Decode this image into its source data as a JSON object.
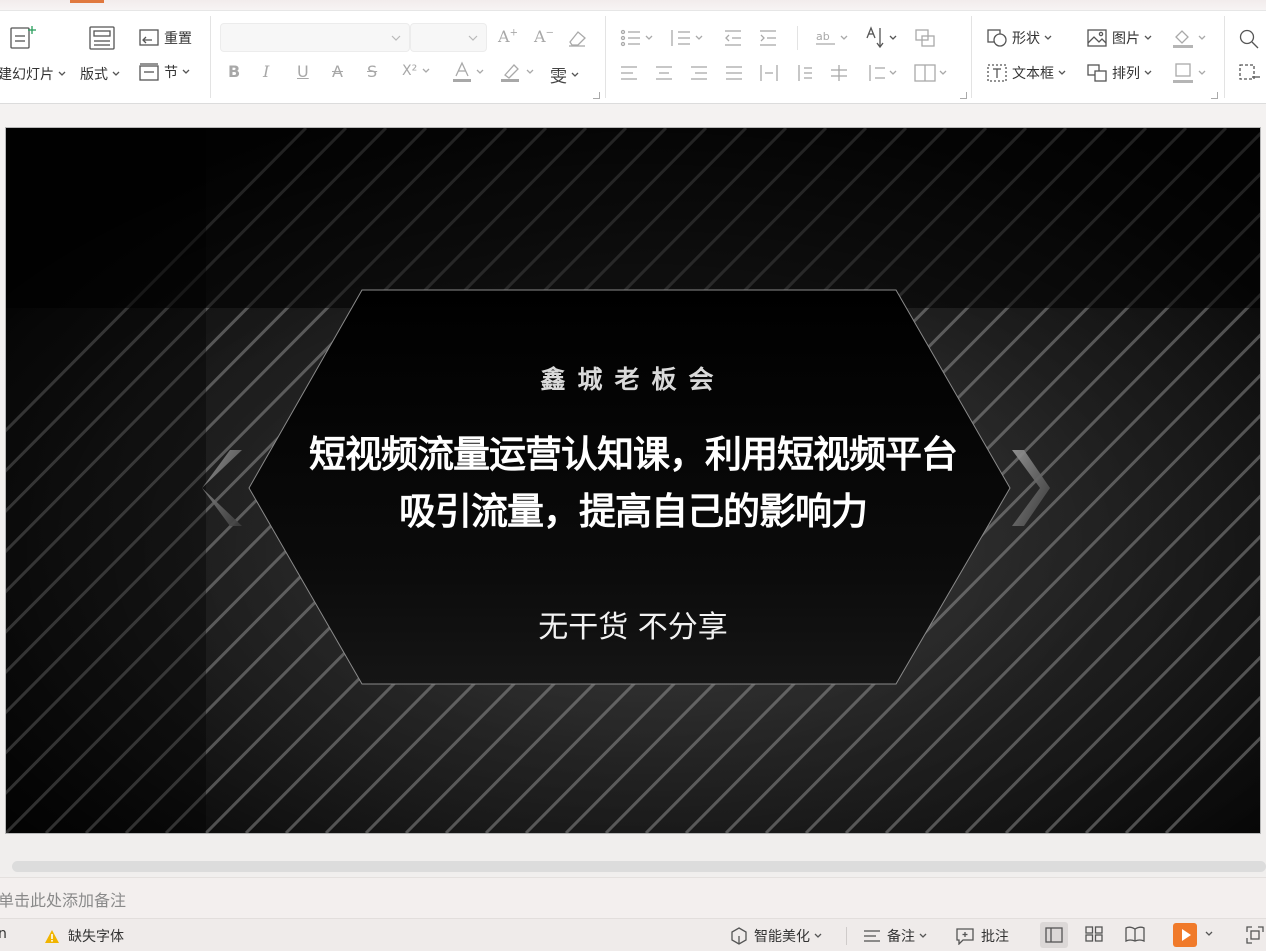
{
  "ribbon": {
    "new_slide_label": "建幻灯片",
    "layout_label": "版式",
    "reset_label": "重置",
    "section_label": "节",
    "font_name_value": "",
    "font_size_value": "",
    "superscript_label": "X²",
    "shape_label": "形状",
    "picture_label": "图片",
    "textbox_label": "文本框",
    "arrange_label": "排列"
  },
  "slide": {
    "org": "鑫城老板会",
    "title_line1": "短视频流量运营认知课，利用短视频平台",
    "title_line2": "吸引流量，提高自己的影响力",
    "subtitle": "无干货 不分享",
    "left_arrow": "❮",
    "right_arrow": "❯"
  },
  "notes": {
    "placeholder": "单击此处添加备注"
  },
  "status": {
    "left_fragment": "n",
    "missing_font": "缺失字体",
    "smart_beautify": "智能美化",
    "notes_label": "备注",
    "comment_label": "批注"
  },
  "colors": {
    "accent": "#e0783e",
    "play": "#f07a2a"
  }
}
